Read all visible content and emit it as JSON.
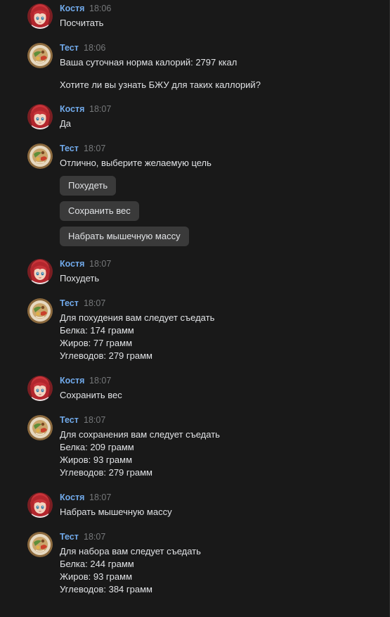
{
  "users": {
    "kostya": {
      "name": "Костя",
      "avatar_icon": "anime-girl-red-hair-avatar-icon"
    },
    "test": {
      "name": "Тест",
      "avatar_icon": "food-plate-avatar-icon"
    }
  },
  "colors": {
    "background": "#191919",
    "name": "#71aaeb",
    "time": "#76787a",
    "text": "#e1e3e6",
    "button": "#3a3a3a"
  },
  "messages": [
    {
      "author": "Костя",
      "time": "18:06",
      "lines": [
        "Посчитать"
      ]
    },
    {
      "author": "Тест",
      "time": "18:06",
      "lines": [
        "Ваша суточная норма калорий: 2797 ккал",
        "",
        "Хотите ли вы узнать БЖУ для таких каллорий?"
      ]
    },
    {
      "author": "Костя",
      "time": "18:07",
      "lines": [
        "Да"
      ]
    },
    {
      "author": "Тест",
      "time": "18:07",
      "lines": [
        "Отлично, выберите желаемую цель"
      ],
      "buttons": [
        "Похудеть",
        "Сохранить вес",
        "Набрать мышечную массу"
      ]
    },
    {
      "author": "Костя",
      "time": "18:07",
      "lines": [
        "Похудеть"
      ]
    },
    {
      "author": "Тест",
      "time": "18:07",
      "lines": [
        "Для похудения вам следует съедать",
        "Белка: 174 грамм",
        "Жиров: 77 грамм",
        "Углеводов: 279 грамм"
      ]
    },
    {
      "author": "Костя",
      "time": "18:07",
      "lines": [
        "Сохранить вес"
      ]
    },
    {
      "author": "Тест",
      "time": "18:07",
      "lines": [
        "Для сохранения вам следует съедать",
        "Белка: 209 грамм",
        "Жиров: 93 грамм",
        "Углеводов: 279 грамм"
      ]
    },
    {
      "author": "Костя",
      "time": "18:07",
      "lines": [
        "Набрать мышечную массу"
      ]
    },
    {
      "author": "Тест",
      "time": "18:07",
      "lines": [
        "Для набора вам следует съедать",
        "Белка: 244 грамм",
        "Жиров: 93 грамм",
        "Углеводов: 384 грамм"
      ]
    }
  ]
}
